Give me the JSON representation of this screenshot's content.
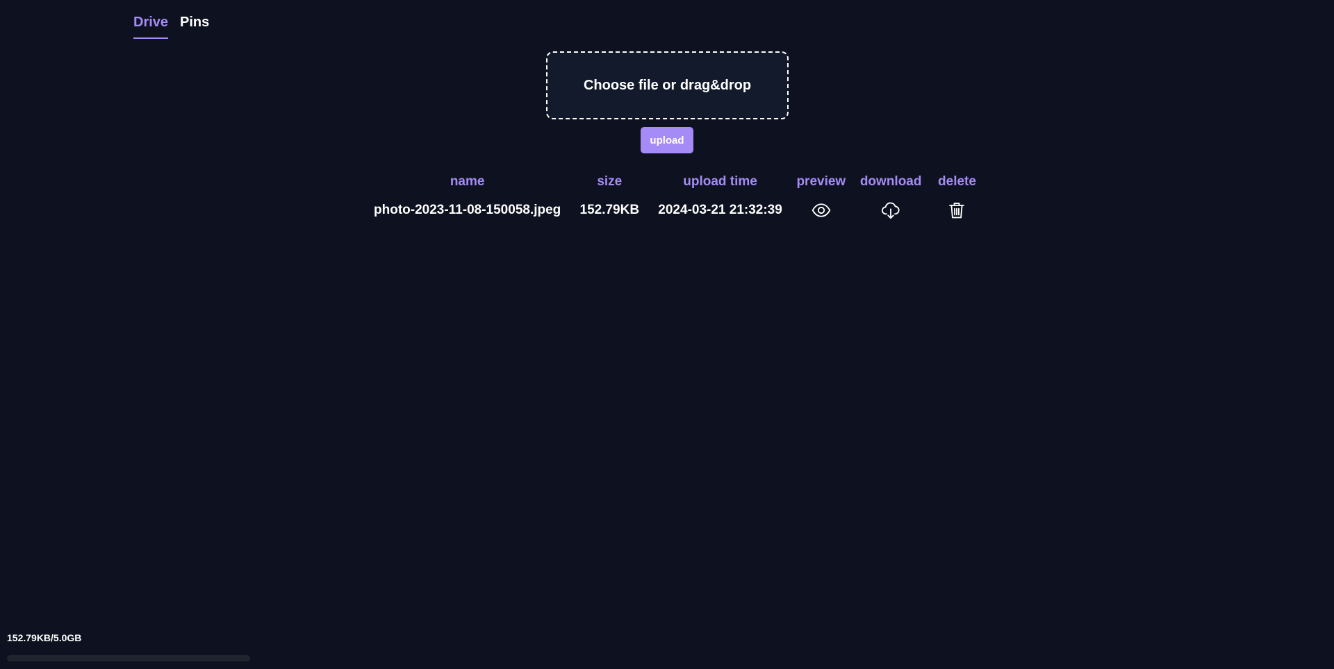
{
  "tabs": [
    {
      "label": "Drive",
      "active": true
    },
    {
      "label": "Pins",
      "active": false
    }
  ],
  "upload": {
    "dropzone_label": "Choose file or drag&drop",
    "button_label": "upload"
  },
  "table": {
    "headers": [
      "name",
      "size",
      "upload time",
      "preview",
      "download",
      "delete"
    ],
    "rows": [
      {
        "name": "photo-2023-11-08-150058.jpeg",
        "size": "152.79KB",
        "upload_time": "2024-03-21 21:32:39",
        "preview_icon": "eye-icon",
        "download_icon": "cloud-download-icon",
        "delete_icon": "trash-icon"
      }
    ]
  },
  "storage": {
    "label": "152.79KB/5.0GB",
    "used_fraction": 3e-05
  },
  "colors": {
    "background": "#0e1220",
    "accent": "#a48bf5",
    "dropzone_bg": "#121a2b",
    "text": "#ffffff"
  }
}
